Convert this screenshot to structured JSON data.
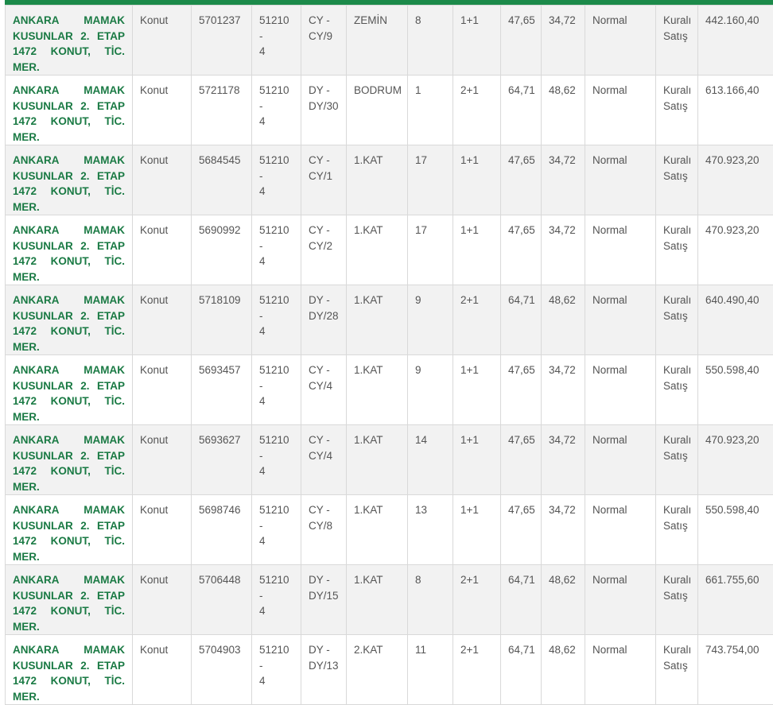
{
  "rows": [
    {
      "loc": [
        "ANKARA MAMAK",
        "KUSUNLAR 2. ETAP",
        "1472 KONUT, TİC. MER."
      ],
      "type": "Konut",
      "id": "5701237",
      "parcel": [
        "51210 -",
        "4"
      ],
      "block": [
        "CY -",
        "CY/9"
      ],
      "floor": "ZEMİN",
      "door": "8",
      "rooms": "1+1",
      "gross": "47,65",
      "net": "34,72",
      "status": "Normal",
      "sale": [
        "Kuralı",
        "Satış"
      ],
      "price": "442.160,40"
    },
    {
      "loc": [
        "ANKARA MAMAK",
        "KUSUNLAR 2. ETAP",
        "1472 KONUT, TİC. MER."
      ],
      "type": "Konut",
      "id": "5721178",
      "parcel": [
        "51210 -",
        "4"
      ],
      "block": [
        "DY -",
        "DY/30"
      ],
      "floor": "BODRUM",
      "door": "1",
      "rooms": "2+1",
      "gross": "64,71",
      "net": "48,62",
      "status": "Normal",
      "sale": [
        "Kuralı",
        "Satış"
      ],
      "price": "613.166,40"
    },
    {
      "loc": [
        "ANKARA MAMAK",
        "KUSUNLAR 2. ETAP",
        "1472 KONUT, TİC. MER."
      ],
      "type": "Konut",
      "id": "5684545",
      "parcel": [
        "51210 -",
        "4"
      ],
      "block": [
        "CY -",
        "CY/1"
      ],
      "floor": "1.KAT",
      "door": "17",
      "rooms": "1+1",
      "gross": "47,65",
      "net": "34,72",
      "status": "Normal",
      "sale": [
        "Kuralı",
        "Satış"
      ],
      "price": "470.923,20"
    },
    {
      "loc": [
        "ANKARA MAMAK",
        "KUSUNLAR 2. ETAP",
        "1472 KONUT, TİC. MER."
      ],
      "type": "Konut",
      "id": "5690992",
      "parcel": [
        "51210 -",
        "4"
      ],
      "block": [
        "CY -",
        "CY/2"
      ],
      "floor": "1.KAT",
      "door": "17",
      "rooms": "1+1",
      "gross": "47,65",
      "net": "34,72",
      "status": "Normal",
      "sale": [
        "Kuralı",
        "Satış"
      ],
      "price": "470.923,20"
    },
    {
      "loc": [
        "ANKARA MAMAK",
        "KUSUNLAR 2. ETAP",
        "1472 KONUT, TİC. MER."
      ],
      "type": "Konut",
      "id": "5718109",
      "parcel": [
        "51210 -",
        "4"
      ],
      "block": [
        "DY -",
        "DY/28"
      ],
      "floor": "1.KAT",
      "door": "9",
      "rooms": "2+1",
      "gross": "64,71",
      "net": "48,62",
      "status": "Normal",
      "sale": [
        "Kuralı",
        "Satış"
      ],
      "price": "640.490,40"
    },
    {
      "loc": [
        "ANKARA MAMAK",
        "KUSUNLAR 2. ETAP",
        "1472 KONUT, TİC. MER."
      ],
      "type": "Konut",
      "id": "5693457",
      "parcel": [
        "51210 -",
        "4"
      ],
      "block": [
        "CY -",
        "CY/4"
      ],
      "floor": "1.KAT",
      "door": "9",
      "rooms": "1+1",
      "gross": "47,65",
      "net": "34,72",
      "status": "Normal",
      "sale": [
        "Kuralı",
        "Satış"
      ],
      "price": "550.598,40"
    },
    {
      "loc": [
        "ANKARA MAMAK",
        "KUSUNLAR 2. ETAP",
        "1472 KONUT, TİC. MER."
      ],
      "type": "Konut",
      "id": "5693627",
      "parcel": [
        "51210 -",
        "4"
      ],
      "block": [
        "CY -",
        "CY/4"
      ],
      "floor": "1.KAT",
      "door": "14",
      "rooms": "1+1",
      "gross": "47,65",
      "net": "34,72",
      "status": "Normal",
      "sale": [
        "Kuralı",
        "Satış"
      ],
      "price": "470.923,20"
    },
    {
      "loc": [
        "ANKARA MAMAK",
        "KUSUNLAR 2. ETAP",
        "1472 KONUT, TİC. MER."
      ],
      "type": "Konut",
      "id": "5698746",
      "parcel": [
        "51210 -",
        "4"
      ],
      "block": [
        "CY -",
        "CY/8"
      ],
      "floor": "1.KAT",
      "door": "13",
      "rooms": "1+1",
      "gross": "47,65",
      "net": "34,72",
      "status": "Normal",
      "sale": [
        "Kuralı",
        "Satış"
      ],
      "price": "550.598,40"
    },
    {
      "loc": [
        "ANKARA MAMAK",
        "KUSUNLAR 2. ETAP",
        "1472 KONUT, TİC. MER."
      ],
      "type": "Konut",
      "id": "5706448",
      "parcel": [
        "51210 -",
        "4"
      ],
      "block": [
        "DY -",
        "DY/15"
      ],
      "floor": "1.KAT",
      "door": "8",
      "rooms": "2+1",
      "gross": "64,71",
      "net": "48,62",
      "status": "Normal",
      "sale": [
        "Kuralı",
        "Satış"
      ],
      "price": "661.755,60"
    },
    {
      "loc": [
        "ANKARA MAMAK",
        "KUSUNLAR 2. ETAP",
        "1472 KONUT, TİC. MER."
      ],
      "type": "Konut",
      "id": "5704903",
      "parcel": [
        "51210 -",
        "4"
      ],
      "block": [
        "DY -",
        "DY/13"
      ],
      "floor": "2.KAT",
      "door": "11",
      "rooms": "2+1",
      "gross": "64,71",
      "net": "48,62",
      "status": "Normal",
      "sale": [
        "Kuralı",
        "Satış"
      ],
      "price": "743.754,00"
    }
  ]
}
